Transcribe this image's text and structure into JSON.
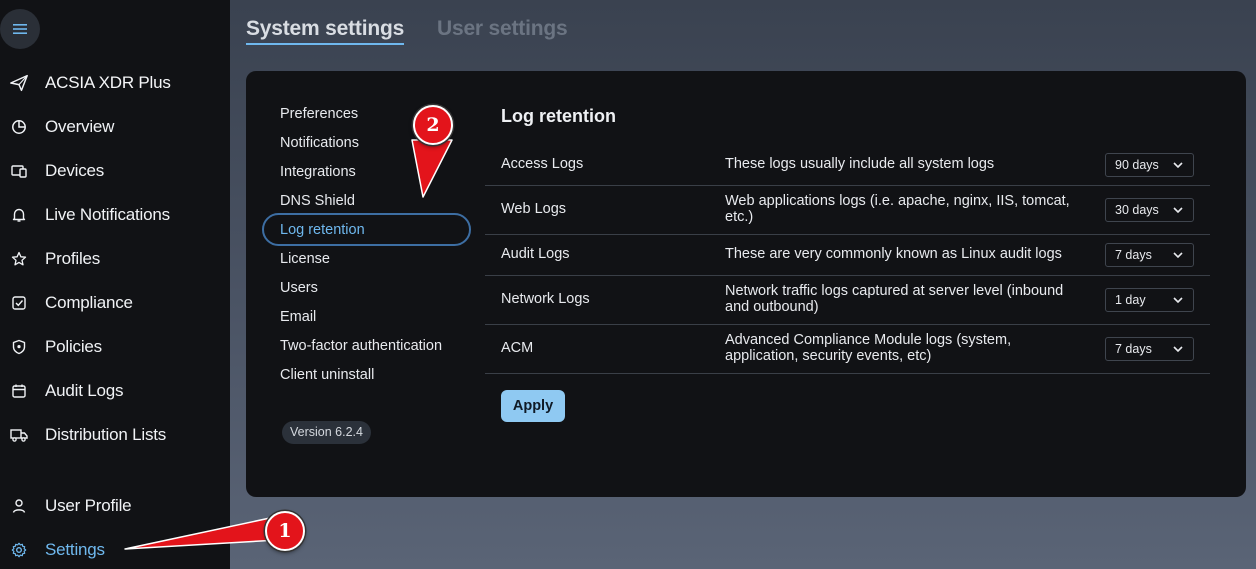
{
  "sidebar": {
    "brand": "ACSIA XDR Plus",
    "items": [
      {
        "label": "Overview",
        "icon": "chart-pie-icon"
      },
      {
        "label": "Devices",
        "icon": "devices-icon"
      },
      {
        "label": "Live Notifications",
        "icon": "bell-icon"
      },
      {
        "label": "Profiles",
        "icon": "star-icon"
      },
      {
        "label": "Compliance",
        "icon": "check-square-icon"
      },
      {
        "label": "Policies",
        "icon": "shield-icon"
      },
      {
        "label": "Audit Logs",
        "icon": "calendar-icon"
      },
      {
        "label": "Distribution Lists",
        "icon": "truck-icon"
      }
    ],
    "bottom": [
      {
        "label": "User Profile",
        "icon": "user-icon"
      },
      {
        "label": "Settings",
        "icon": "gear-icon"
      }
    ]
  },
  "tabs": {
    "system": "System settings",
    "user": "User settings"
  },
  "settings_nav": [
    "Preferences",
    "Notifications",
    "Integrations",
    "DNS Shield",
    "Log retention",
    "License",
    "Users",
    "Email",
    "Two-factor authentication",
    "Client uninstall"
  ],
  "version": "Version 6.2.4",
  "log_retention": {
    "title": "Log retention",
    "rows": [
      {
        "name": "Access Logs",
        "description": "These logs usually include all system logs",
        "value": "90 days"
      },
      {
        "name": "Web Logs",
        "description": "Web applications logs (i.e. apache, nginx, IIS, tomcat, etc.)",
        "value": "30 days"
      },
      {
        "name": "Audit Logs",
        "description": "These are very commonly known as Linux audit logs",
        "value": "7 days"
      },
      {
        "name": "Network Logs",
        "description": "Network traffic logs captured at server level (inbound and outbound)",
        "value": "1 day"
      },
      {
        "name": "ACM",
        "description": "Advanced Compliance Module logs (system, application, security events, etc)",
        "value": "7 days"
      }
    ],
    "apply_label": "Apply"
  },
  "annotations": {
    "marker_1": "1",
    "marker_2": "2"
  },
  "colors": {
    "accent": "#6fb8ee",
    "sidebar_bg": "#111215",
    "card_bg": "#111215",
    "marker_red": "#e3141b"
  }
}
